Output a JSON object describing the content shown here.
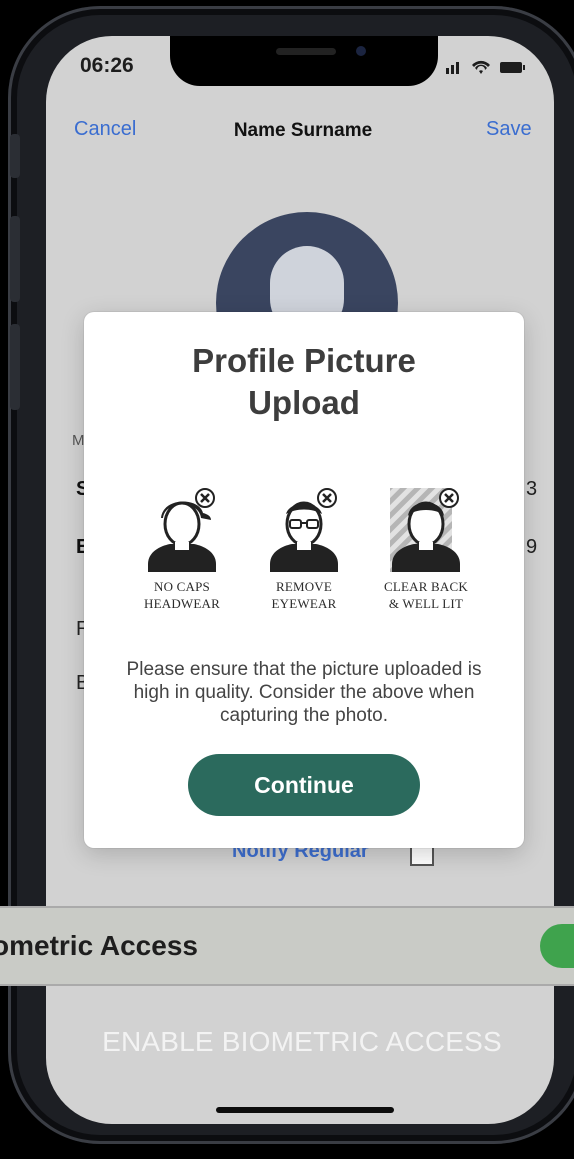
{
  "status_bar": {
    "time": "06:26",
    "icons": "signal wifi battery"
  },
  "nav": {
    "cancel": "Cancel",
    "title": "Name Surname",
    "save": "Save"
  },
  "background_fragments": {
    "m": "M",
    "s": "S",
    "e": "E",
    "r": "R",
    "b": "B",
    "num_1": "3",
    "num_2": "9"
  },
  "notify": {
    "label": "Notify Regular"
  },
  "settings_row": {
    "label": "ometric Access",
    "toggle_on": true
  },
  "caption": "ENABLE BIOMETRIC ACCESS",
  "modal": {
    "title_line1": "Profile Picture",
    "title_line2": "Upload",
    "guides": [
      {
        "icon": "no-caps-icon",
        "line1": "NO CAPS",
        "line2": "HEADWEAR"
      },
      {
        "icon": "no-eyewear-icon",
        "line1": "REMOVE",
        "line2": "EYEWEAR"
      },
      {
        "icon": "clear-background-icon",
        "line1": "CLEAR BACK",
        "line2": "& WELL LIT"
      }
    ],
    "message": "Please ensure that the picture uploaded is high in quality. Consider the above when capturing the photo.",
    "continue_label": "Continue"
  },
  "colors": {
    "link_blue": "#3a6dd0",
    "continue_green": "#2b6a5d",
    "avatar_navy": "#3a4560",
    "toggle_green": "#3fa34d"
  }
}
